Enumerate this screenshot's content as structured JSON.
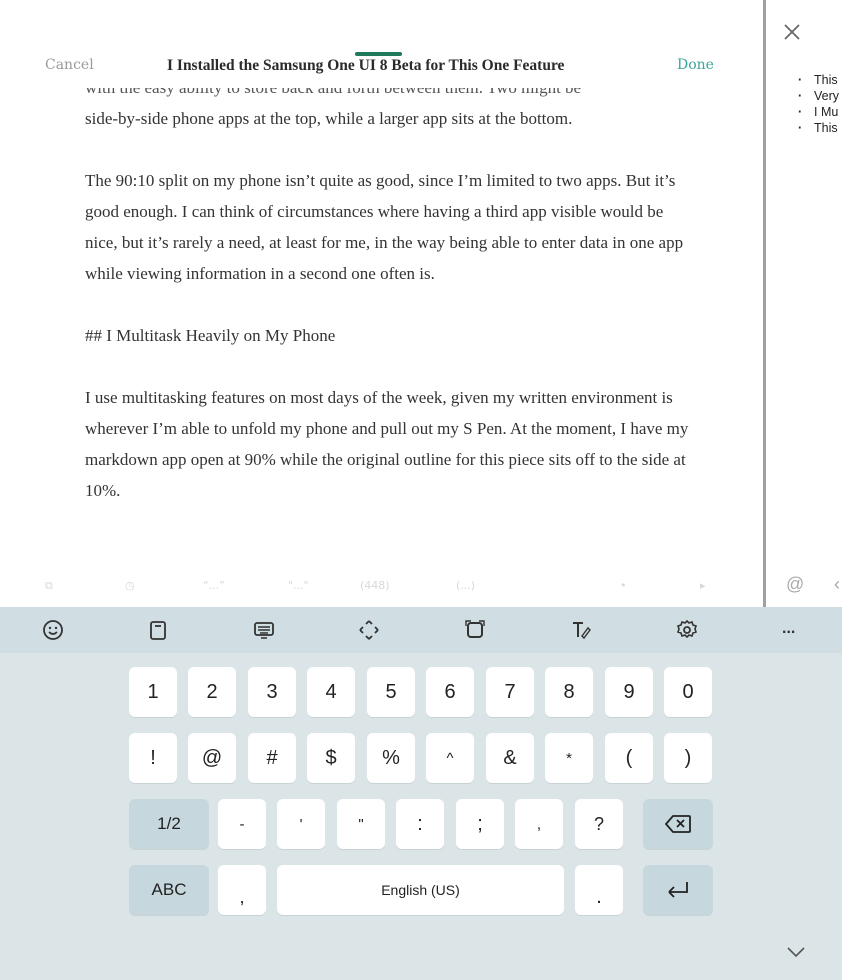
{
  "editor": {
    "cancel_label": "Cancel",
    "title": "I Installed the Samsung One UI 8 Beta for This One Feature",
    "done_label": "Done",
    "partial_line": "with the easy ability to store back and forth between them. Two might be",
    "paragraphs": [
      "side-by-side phone apps at the top, while a larger app sits at the bottom.",
      "The 90:10 split on my phone isn’t quite as good, since I’m limited to two apps. But it’s good enough. I can think of circumstances where having a third app visible would be nice, but it’s rarely a need, at least for me,  in the way being able to enter data in one app while viewing information in a second one often is.",
      "## I Multitask Heavily on My Phone",
      "I use multitasking features on most days of the week, given my written environment is wherever I’m able to unfold my phone and pull out my S Pen. At the moment, I have my markdown app open at 90% while the original outline for this piece sits off to the side at 10%."
    ],
    "format_toolbar": [
      "link-icon",
      "clock-icon",
      "“...”",
      "\"...\"",
      "(448)",
      "(...)",
      "•",
      "▸"
    ]
  },
  "side_panel": {
    "outline": [
      "This",
      "Very",
      "I Mu",
      "This"
    ],
    "at_symbol": "@",
    "more_label": "...",
    "close_icon": "close-icon",
    "chevron_icon": "chevron-down-icon"
  },
  "keyboard": {
    "toolbar_icons": [
      "emoji-icon",
      "clipboard-icon",
      "keyboard-icon",
      "text-cursor-icon",
      "screen-capture-icon",
      "handwriting-icon",
      "settings-icon"
    ],
    "row1": [
      "1",
      "2",
      "3",
      "4",
      "5",
      "6",
      "7",
      "8",
      "9",
      "0"
    ],
    "row2": [
      "!",
      "@",
      "#",
      "$",
      "%",
      "^",
      "&",
      "*",
      "(",
      ")"
    ],
    "row3": [
      "1/2",
      "-",
      "'",
      "\"",
      ":",
      ";",
      ",",
      "?"
    ],
    "row4": {
      "abc": "ABC",
      "comma": ",",
      "space": "English (US)",
      "period": "."
    },
    "colors": {
      "background": "#dbe5e8",
      "key": "#ffffff",
      "function_key": "#c6d8de",
      "accent": "#1f7a5c"
    }
  }
}
